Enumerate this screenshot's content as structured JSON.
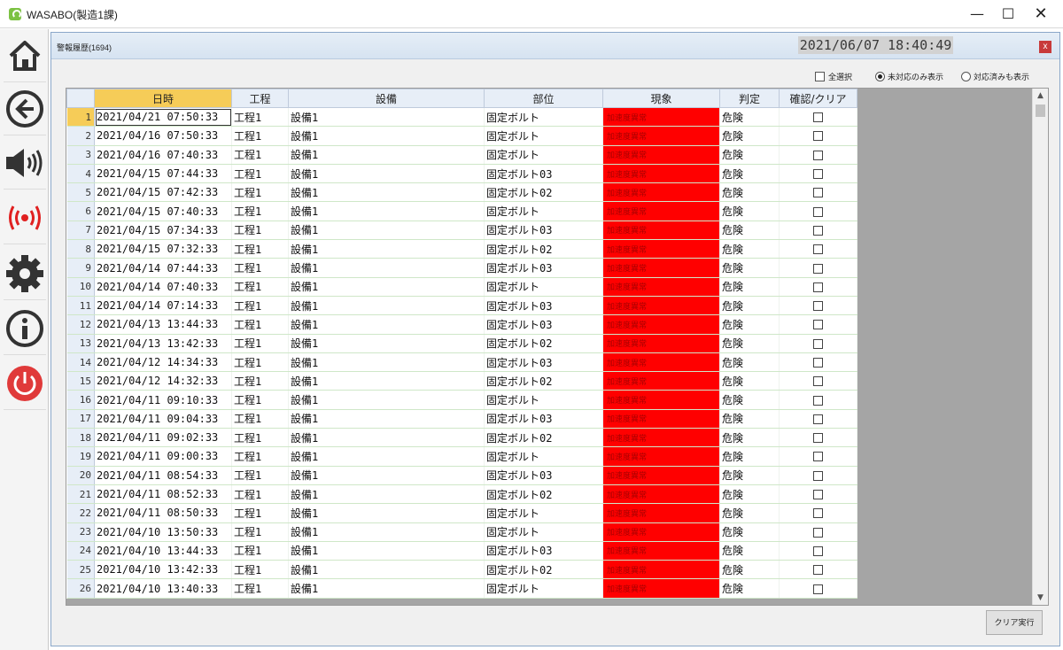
{
  "window": {
    "title": "WASABO(製造1課)",
    "minimize": "—",
    "maximize": "☐",
    "close": "✕"
  },
  "sidebar": {
    "items": [
      {
        "icon": "home-icon"
      },
      {
        "icon": "back-arrow-icon"
      },
      {
        "icon": "speaker-icon"
      },
      {
        "icon": "wireless-alarm-icon",
        "color": "#e02020"
      },
      {
        "icon": "gear-icon"
      },
      {
        "icon": "info-icon"
      },
      {
        "icon": "power-icon",
        "color": "#e03a3a"
      }
    ]
  },
  "panel": {
    "title": "警報履歴(1694)",
    "datetime": "2021/06/07 18:40:49",
    "close": "x"
  },
  "filters": {
    "select_all": "全選択",
    "unhandled_only": "未対応のみ表示",
    "include_handled": "対応済みも表示",
    "selected": "unhandled_only"
  },
  "grid": {
    "columns": [
      "日時",
      "工程",
      "設備",
      "部位",
      "現象",
      "判定",
      "確認/クリア"
    ],
    "rows": [
      {
        "no": "1",
        "datetime": "2021/04/21 07:50:33",
        "process": "工程1",
        "equipment": "設備1",
        "part": "固定ボルト",
        "phenomenon": "加速度異常",
        "judgement": "危険"
      },
      {
        "no": "2",
        "datetime": "2021/04/16 07:50:33",
        "process": "工程1",
        "equipment": "設備1",
        "part": "固定ボルト",
        "phenomenon": "加速度異常",
        "judgement": "危険"
      },
      {
        "no": "3",
        "datetime": "2021/04/16 07:40:33",
        "process": "工程1",
        "equipment": "設備1",
        "part": "固定ボルト",
        "phenomenon": "加速度異常",
        "judgement": "危険"
      },
      {
        "no": "4",
        "datetime": "2021/04/15 07:44:33",
        "process": "工程1",
        "equipment": "設備1",
        "part": "固定ボルト03",
        "phenomenon": "加速度異常",
        "judgement": "危険"
      },
      {
        "no": "5",
        "datetime": "2021/04/15 07:42:33",
        "process": "工程1",
        "equipment": "設備1",
        "part": "固定ボルト02",
        "phenomenon": "加速度異常",
        "judgement": "危険"
      },
      {
        "no": "6",
        "datetime": "2021/04/15 07:40:33",
        "process": "工程1",
        "equipment": "設備1",
        "part": "固定ボルト",
        "phenomenon": "加速度異常",
        "judgement": "危険"
      },
      {
        "no": "7",
        "datetime": "2021/04/15 07:34:33",
        "process": "工程1",
        "equipment": "設備1",
        "part": "固定ボルト03",
        "phenomenon": "加速度異常",
        "judgement": "危険"
      },
      {
        "no": "8",
        "datetime": "2021/04/15 07:32:33",
        "process": "工程1",
        "equipment": "設備1",
        "part": "固定ボルト02",
        "phenomenon": "加速度異常",
        "judgement": "危険"
      },
      {
        "no": "9",
        "datetime": "2021/04/14 07:44:33",
        "process": "工程1",
        "equipment": "設備1",
        "part": "固定ボルト03",
        "phenomenon": "加速度異常",
        "judgement": "危険"
      },
      {
        "no": "10",
        "datetime": "2021/04/14 07:40:33",
        "process": "工程1",
        "equipment": "設備1",
        "part": "固定ボルト",
        "phenomenon": "加速度異常",
        "judgement": "危険"
      },
      {
        "no": "11",
        "datetime": "2021/04/14 07:14:33",
        "process": "工程1",
        "equipment": "設備1",
        "part": "固定ボルト03",
        "phenomenon": "加速度異常",
        "judgement": "危険"
      },
      {
        "no": "12",
        "datetime": "2021/04/13 13:44:33",
        "process": "工程1",
        "equipment": "設備1",
        "part": "固定ボルト03",
        "phenomenon": "加速度異常",
        "judgement": "危険"
      },
      {
        "no": "13",
        "datetime": "2021/04/13 13:42:33",
        "process": "工程1",
        "equipment": "設備1",
        "part": "固定ボルト02",
        "phenomenon": "加速度異常",
        "judgement": "危険"
      },
      {
        "no": "14",
        "datetime": "2021/04/12 14:34:33",
        "process": "工程1",
        "equipment": "設備1",
        "part": "固定ボルト03",
        "phenomenon": "加速度異常",
        "judgement": "危険"
      },
      {
        "no": "15",
        "datetime": "2021/04/12 14:32:33",
        "process": "工程1",
        "equipment": "設備1",
        "part": "固定ボルト02",
        "phenomenon": "加速度異常",
        "judgement": "危険"
      },
      {
        "no": "16",
        "datetime": "2021/04/11 09:10:33",
        "process": "工程1",
        "equipment": "設備1",
        "part": "固定ボルト",
        "phenomenon": "加速度異常",
        "judgement": "危険"
      },
      {
        "no": "17",
        "datetime": "2021/04/11 09:04:33",
        "process": "工程1",
        "equipment": "設備1",
        "part": "固定ボルト03",
        "phenomenon": "加速度異常",
        "judgement": "危険"
      },
      {
        "no": "18",
        "datetime": "2021/04/11 09:02:33",
        "process": "工程1",
        "equipment": "設備1",
        "part": "固定ボルト02",
        "phenomenon": "加速度異常",
        "judgement": "危険"
      },
      {
        "no": "19",
        "datetime": "2021/04/11 09:00:33",
        "process": "工程1",
        "equipment": "設備1",
        "part": "固定ボルト",
        "phenomenon": "加速度異常",
        "judgement": "危険"
      },
      {
        "no": "20",
        "datetime": "2021/04/11 08:54:33",
        "process": "工程1",
        "equipment": "設備1",
        "part": "固定ボルト03",
        "phenomenon": "加速度異常",
        "judgement": "危険"
      },
      {
        "no": "21",
        "datetime": "2021/04/11 08:52:33",
        "process": "工程1",
        "equipment": "設備1",
        "part": "固定ボルト02",
        "phenomenon": "加速度異常",
        "judgement": "危険"
      },
      {
        "no": "22",
        "datetime": "2021/04/11 08:50:33",
        "process": "工程1",
        "equipment": "設備1",
        "part": "固定ボルト",
        "phenomenon": "加速度異常",
        "judgement": "危険"
      },
      {
        "no": "23",
        "datetime": "2021/04/10 13:50:33",
        "process": "工程1",
        "equipment": "設備1",
        "part": "固定ボルト",
        "phenomenon": "加速度異常",
        "judgement": "危険"
      },
      {
        "no": "24",
        "datetime": "2021/04/10 13:44:33",
        "process": "工程1",
        "equipment": "設備1",
        "part": "固定ボルト03",
        "phenomenon": "加速度異常",
        "judgement": "危険"
      },
      {
        "no": "25",
        "datetime": "2021/04/10 13:42:33",
        "process": "工程1",
        "equipment": "設備1",
        "part": "固定ボルト02",
        "phenomenon": "加速度異常",
        "judgement": "危険"
      },
      {
        "no": "26",
        "datetime": "2021/04/10 13:40:33",
        "process": "工程1",
        "equipment": "設備1",
        "part": "固定ボルト",
        "phenomenon": "加速度異常",
        "judgement": "危険"
      }
    ]
  },
  "scroll": {
    "up": "▲",
    "down": "▼"
  },
  "actions": {
    "clear": "クリア実行"
  },
  "colors": {
    "alarm_red": "#ff0000",
    "selected_header": "#f6cc58",
    "row_line": "#cfe7c8"
  }
}
